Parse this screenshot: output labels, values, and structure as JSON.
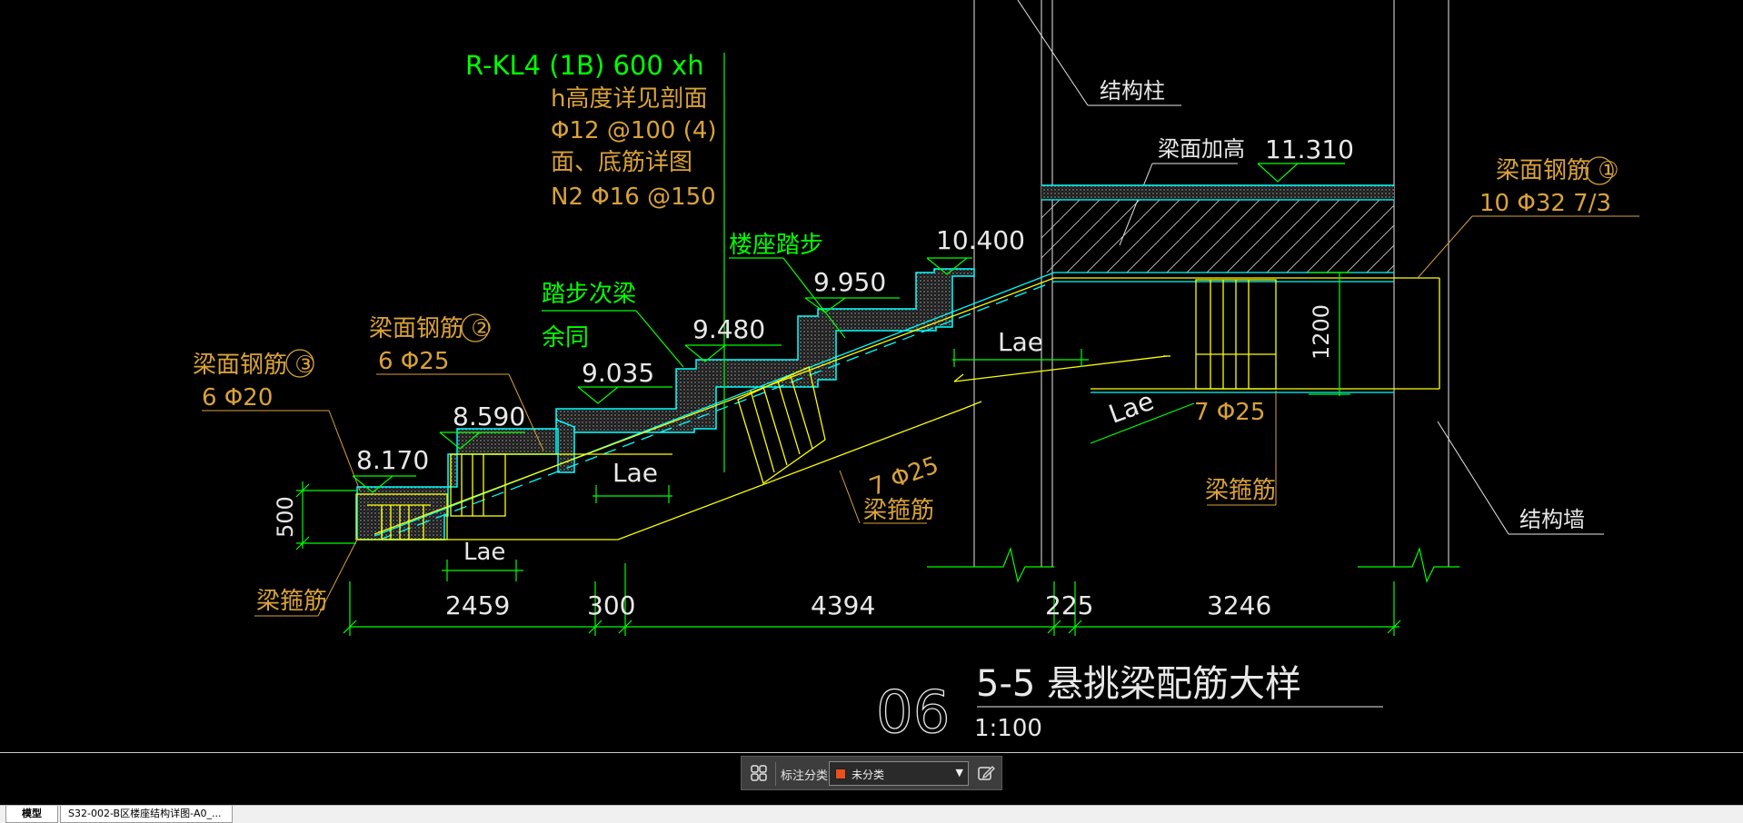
{
  "drawing": {
    "beam_label": "R-KL4 (1B)  600 xh",
    "beam_notes": [
      "h高度详见剖面",
      "Φ12 @100 (4)",
      "面、底筋详图",
      "N2 Φ16 @150"
    ],
    "struct_column": "结构柱",
    "beam_top_raise": "梁面加高",
    "elev_top": "11.310",
    "rebar1_label": "梁面钢筋 ①",
    "rebar1_value": "10 Φ32  7/3",
    "stair_step": "楼座踏步",
    "elev_10400": "10.400",
    "elev_9950": "9.950",
    "step_secondary_beam": "踏步次梁",
    "remaining_same": "余同",
    "elev_9480": "9.480",
    "rebar2_label": "梁面钢筋 ②",
    "rebar2_value": "6 Φ25",
    "elev_9035": "9.035",
    "rebar3_label": "梁面钢筋 ③",
    "rebar3_value": "6 Φ20",
    "elev_8590": "8.590",
    "elev_8170": "8.170",
    "lae": "Lae",
    "bottom_rebar_7": "7 Φ25",
    "stirrup": "梁箍筋",
    "struct_wall": "结构墙",
    "dim_500": "500",
    "dim_1200": "1200",
    "dims": [
      "2459",
      "300",
      "4394",
      "225",
      "3246"
    ],
    "title_number": "06",
    "title_text": "5-5  悬挑梁配筋大样",
    "scale": "1:100"
  },
  "toolbar": {
    "label": "标注分类",
    "category": "未分类",
    "category_color": "#e8501c"
  },
  "tabs": {
    "model": "模型",
    "layout": "S32-002-B区楼座结构详图-A0_..."
  },
  "colors": {
    "green": "#00ff00",
    "yellow": "#ffff00",
    "cyan": "#00ffff",
    "orange": "#d9a23a",
    "white": "#ffffff"
  }
}
